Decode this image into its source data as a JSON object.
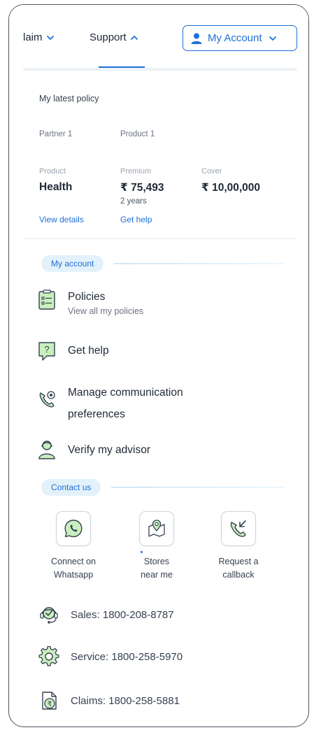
{
  "nav": {
    "claim_label": "laim",
    "support_label": "Support",
    "account_label": "My Account"
  },
  "policy": {
    "title": "My latest policy",
    "partner": "Partner 1",
    "product_name": "Product 1",
    "product_label": "Product",
    "product_value": "Health",
    "premium_label": "Premium",
    "premium_value": "₹ 75,493",
    "premium_term": "2 years",
    "cover_label": "Cover",
    "cover_value": "₹ 10,00,000",
    "view_details": "View details",
    "get_help": "Get help"
  },
  "account_section": {
    "title": "My account",
    "items": [
      {
        "label": "Policies",
        "sub": "View all my policies",
        "icon": "policy-document-icon"
      },
      {
        "label": "Get help",
        "sub": "",
        "icon": "help-chat-icon"
      },
      {
        "label": "Manage communication preferences",
        "sub": "",
        "icon": "phone-preferences-icon"
      },
      {
        "label": "Verify my advisor",
        "sub": "",
        "icon": "advisor-icon"
      }
    ]
  },
  "contact_section": {
    "title": "Contact us",
    "cards": [
      {
        "line1": "Connect on",
        "line2": "Whatsapp",
        "icon": "whatsapp-icon"
      },
      {
        "line1": "Stores",
        "line2": "near me",
        "icon": "store-location-icon"
      },
      {
        "line1": "Request a",
        "line2": "callback",
        "icon": "callback-icon"
      }
    ],
    "phones": [
      {
        "label": "Sales: 1800-208-8787",
        "icon": "sales-headset-icon"
      },
      {
        "label": "Service: 1800-258-5970",
        "icon": "service-gear-icon"
      },
      {
        "label": "Claims: 1800-258-5881",
        "icon": "claims-rupee-icon"
      }
    ]
  },
  "colors": {
    "accent": "#1d6fd8",
    "icon_green": "#c8efbd",
    "pill_bg": "#e3f1fb"
  }
}
